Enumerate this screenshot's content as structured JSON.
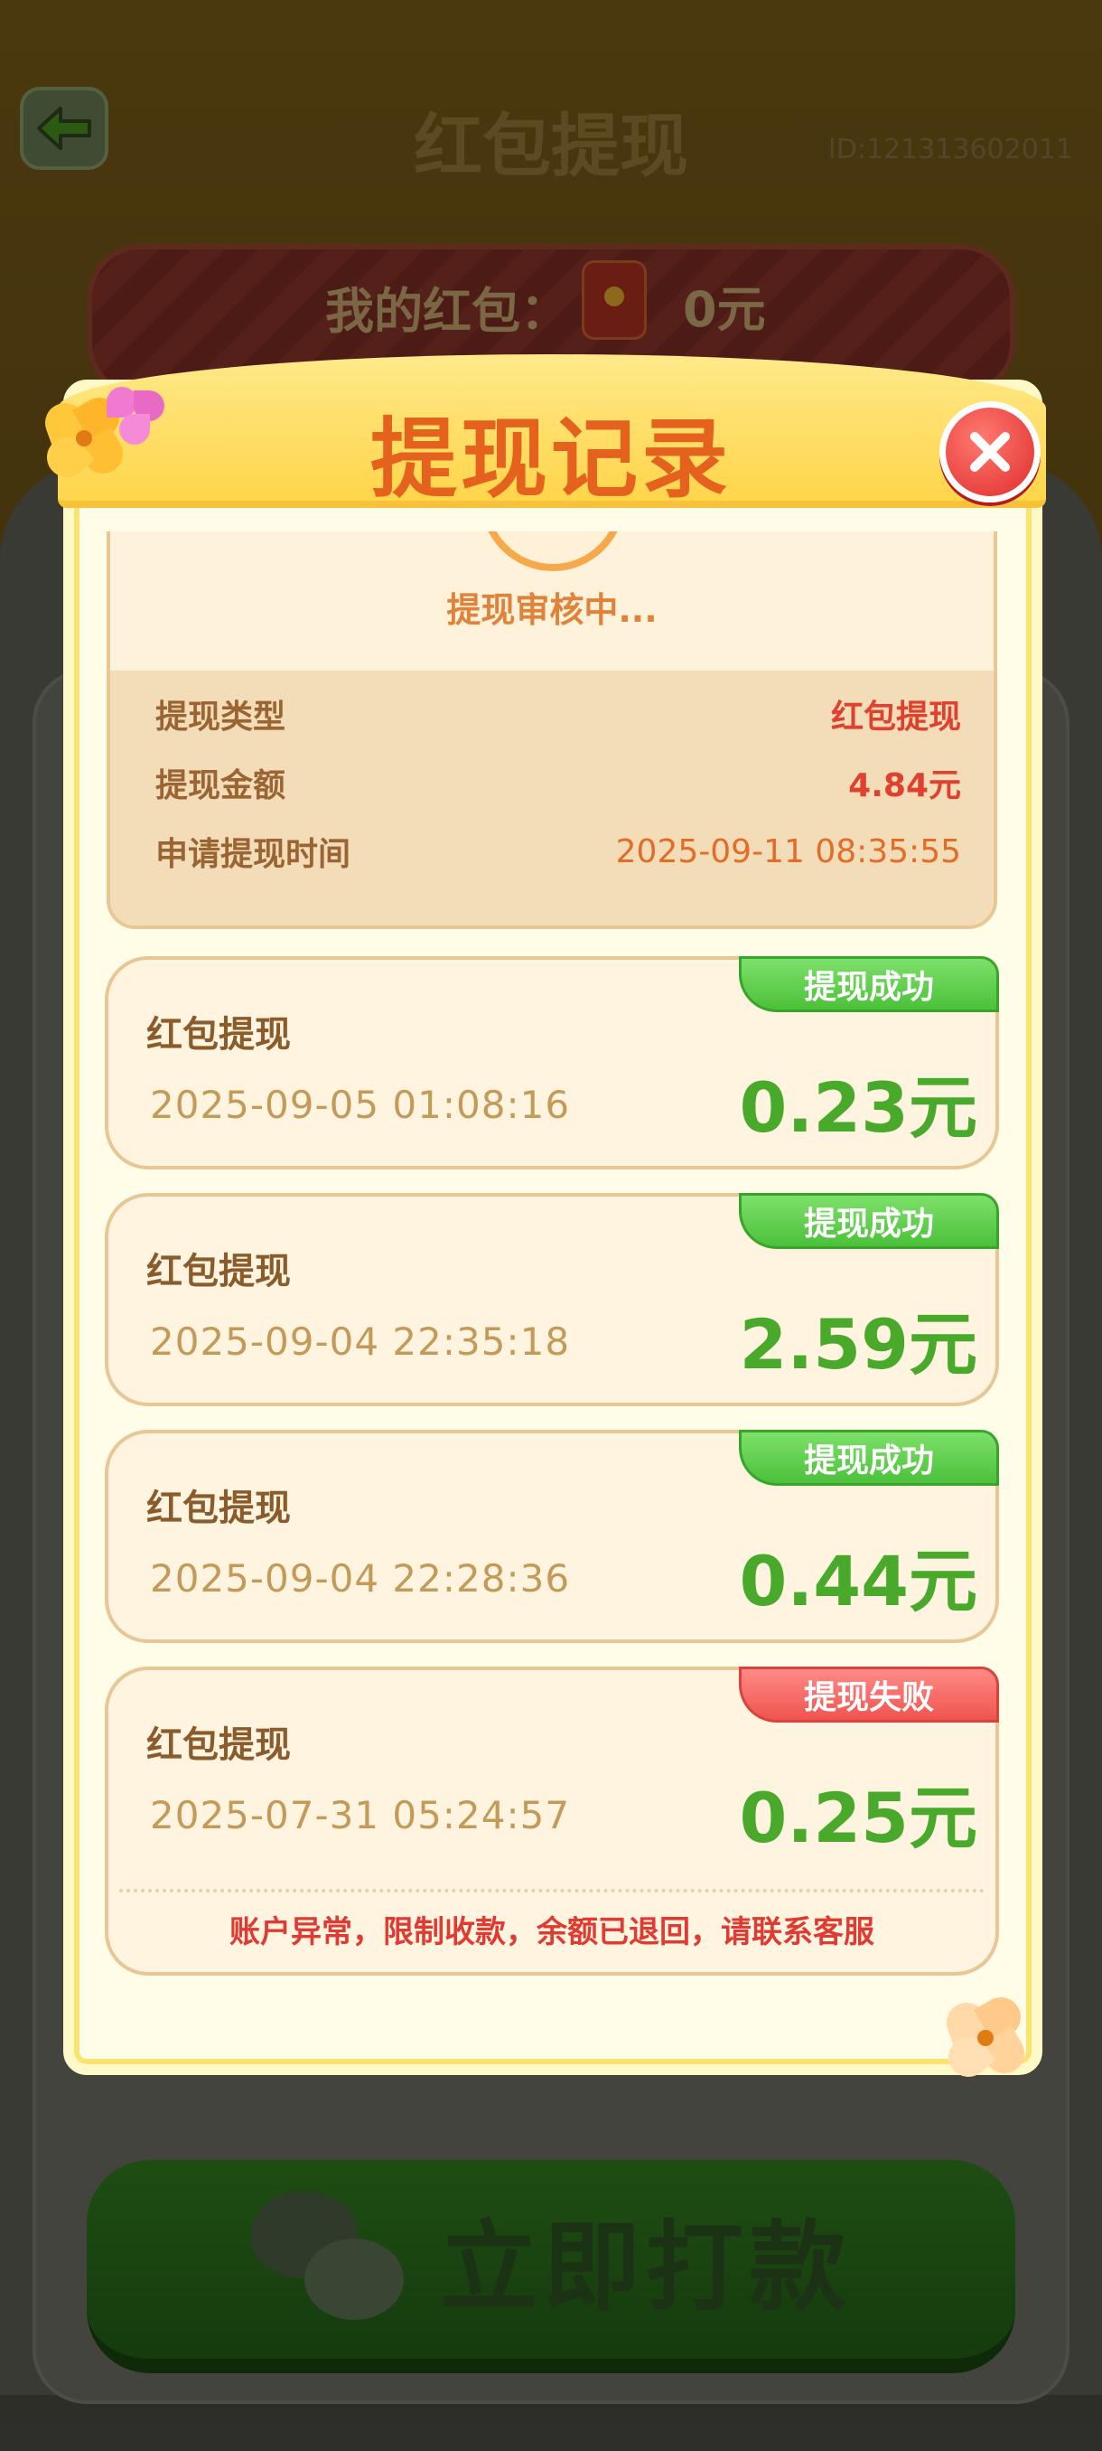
{
  "header": {
    "title": "红包提现",
    "user_id": "ID:121313602011"
  },
  "wallet": {
    "label": "我的红包：",
    "value": "0元"
  },
  "pay_button": {
    "label": "立即打款"
  },
  "modal": {
    "title": "提现记录",
    "pending": {
      "status": "提现审核中...",
      "rows": [
        {
          "key": "提现类型",
          "value": "红包提现"
        },
        {
          "key": "提现金额",
          "value": "4.84元"
        },
        {
          "key": "申请提现时间",
          "value": "2025-09-11 08:35:55"
        }
      ]
    },
    "records": [
      {
        "type": "红包提现",
        "time": "2025-09-05 01:08:16",
        "amount": "0.23元",
        "status": "提现成功",
        "note": ""
      },
      {
        "type": "红包提现",
        "time": "2025-09-04 22:35:18",
        "amount": "2.59元",
        "status": "提现成功",
        "note": ""
      },
      {
        "type": "红包提现",
        "time": "2025-09-04 22:28:36",
        "amount": "0.44元",
        "status": "提现成功",
        "note": ""
      },
      {
        "type": "红包提现",
        "time": "2025-07-31 05:24:57",
        "amount": "0.25元",
        "status": "提现失败",
        "note": "账户异常，限制收款，余额已退回，请联系客服"
      }
    ]
  },
  "colors": {
    "success": "#4cc13a",
    "failure": "#f0544f",
    "title": "#e5621e",
    "amount": "#48a92b"
  },
  "icons": {
    "back": "back-arrow-icon",
    "close": "close-icon",
    "wechat": "wechat-icon",
    "red_packet": "red-packet-icon"
  }
}
